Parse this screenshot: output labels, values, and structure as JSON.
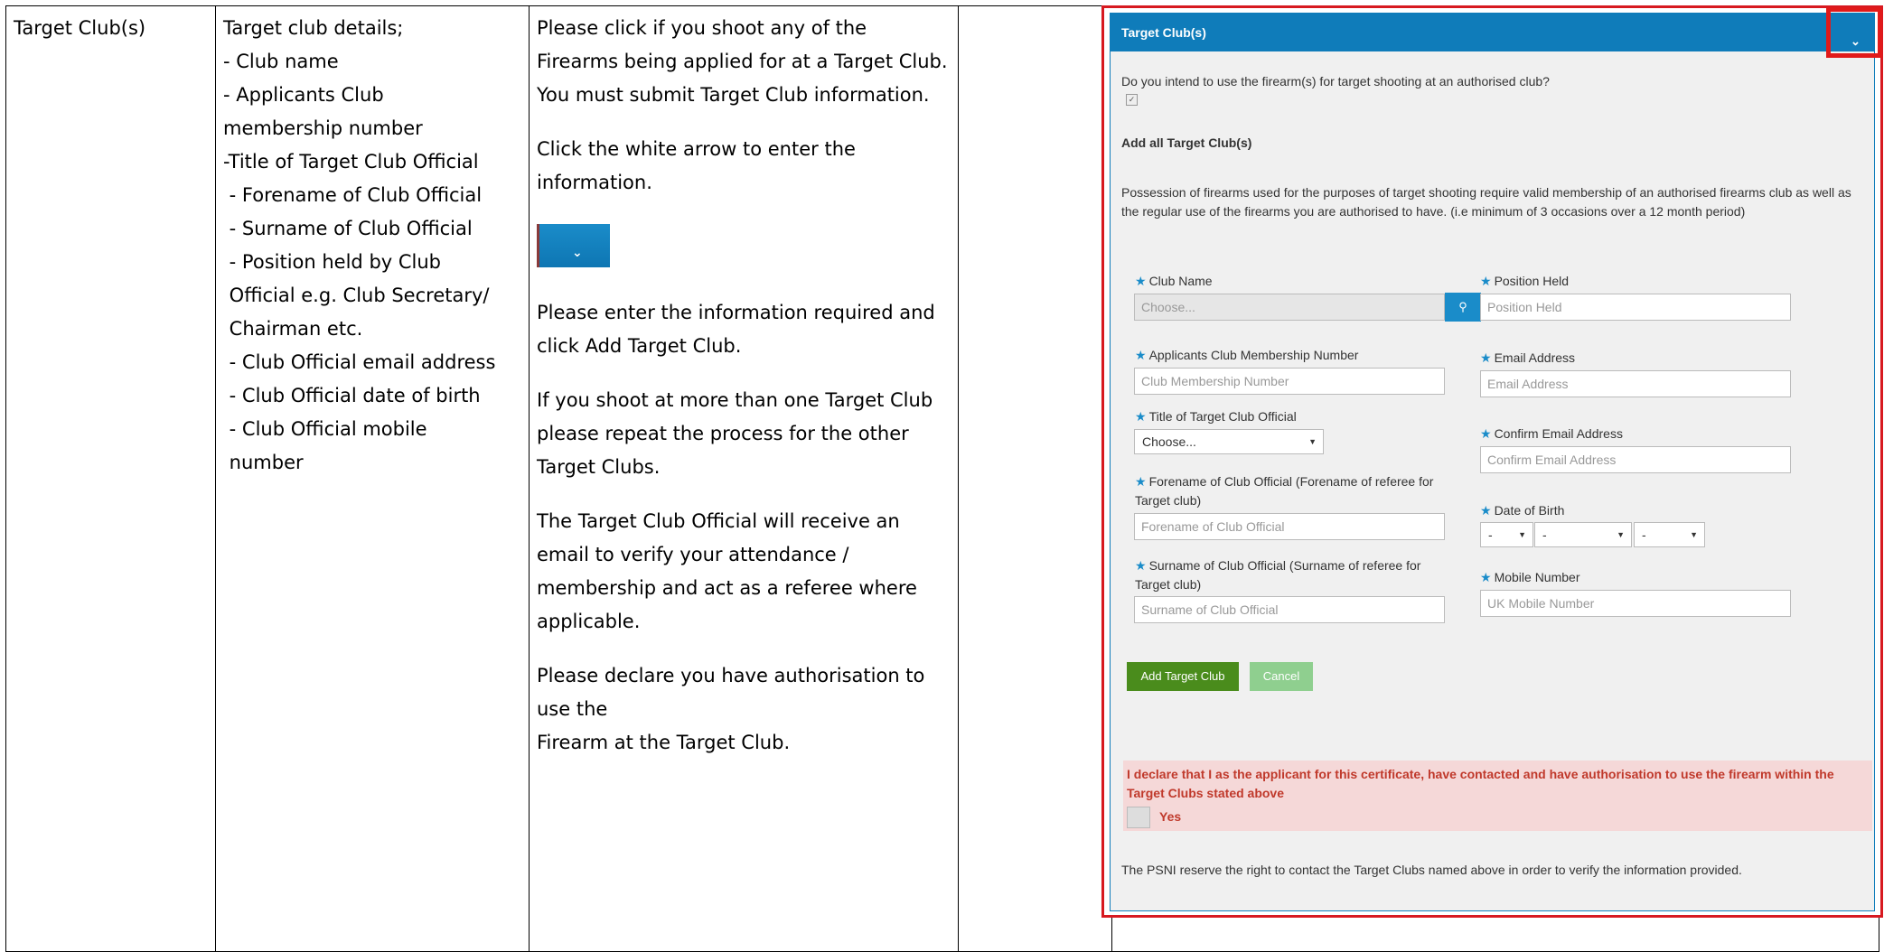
{
  "doc": {
    "col1": "Target Club(s)",
    "col2_lines": [
      "Target club details;",
      "- Club name",
      "- Applicants Club",
      "membership number",
      "-Title of Target Club Official",
      " - Forename of Club Official",
      " - Surname of Club Official",
      " - Position held by Club",
      " Official e.g. Club Secretary/",
      " Chairman etc.",
      " - Club Official email address",
      " - Club Official date of birth",
      " - Club Official mobile",
      " number"
    ],
    "col3_p1": "Please click if you shoot any of the Firearms being applied for at a Target Club. You must submit Target Club information.",
    "col3_p2": "Click the white arrow to enter the information.",
    "col3_p3": "Please enter the information required and click Add Target Club.",
    "col3_p4": "If you shoot at more than one Target Club please repeat the process for the other Target Clubs.",
    "col3_p5": "The Target Club Official will receive an email to verify your attendance / membership and act as a referee where applicable.",
    "col3_p6a": "Please declare you have authorisation to use the",
    "col3_p6b": "Firearm at the Target Club."
  },
  "panel": {
    "title": "Target Club(s)",
    "question": "Do you intend to use the firearm(s) for target shooting at an authorised club?",
    "add_heading": "Add all Target Club(s)",
    "note": "Possession of firearms used for the purposes of target shooting require valid membership of an authorised firearms club as well as the regular use of the firearms you are authorised to have. (i.e minimum of 3 occasions over a 12 month period)",
    "club_name_label": "Club Name",
    "club_name_placeholder": "Choose...",
    "position_label": "Position Held",
    "position_placeholder": "Position Held",
    "membership_label": "Applicants Club Membership Number",
    "membership_placeholder": "Club Membership Number",
    "email_label": "Email Address",
    "email_placeholder": "Email Address",
    "title_label": "Title of Target Club Official",
    "title_value": "Choose...",
    "confirm_email_label": "Confirm Email Address",
    "confirm_email_placeholder": "Confirm Email Address",
    "forename_label_1": "Forename of Club Official (Forename of referee for",
    "forename_label_2": "Target club)",
    "forename_placeholder": "Forename of Club Official",
    "dob_label": "Date of Birth",
    "dob_day": "-",
    "dob_month": "-",
    "dob_year": "-",
    "surname_label_1": "Surname of Club Official (Surname of referee for",
    "surname_label_2": "Target club)",
    "surname_placeholder": "Surname of Club Official",
    "mobile_label": "Mobile Number",
    "mobile_placeholder": "UK Mobile Number",
    "add_button": "Add Target Club",
    "cancel_button": "Cancel",
    "declaration": "I declare that I as the applicant for this certificate, have contacted and have authorisation to use the firearm within the Target Clubs stated above",
    "yes_label": "Yes",
    "footer": "The PSNI reserve the right to contact the Target Clubs named above in order to verify the information provided."
  },
  "colors": {
    "header_blue": "#0f7cba",
    "highlight_red": "#e11a1a",
    "add_green": "#4a8c1c",
    "cancel_green": "#8fcf8f",
    "declare_bg": "#f5d8d8"
  }
}
